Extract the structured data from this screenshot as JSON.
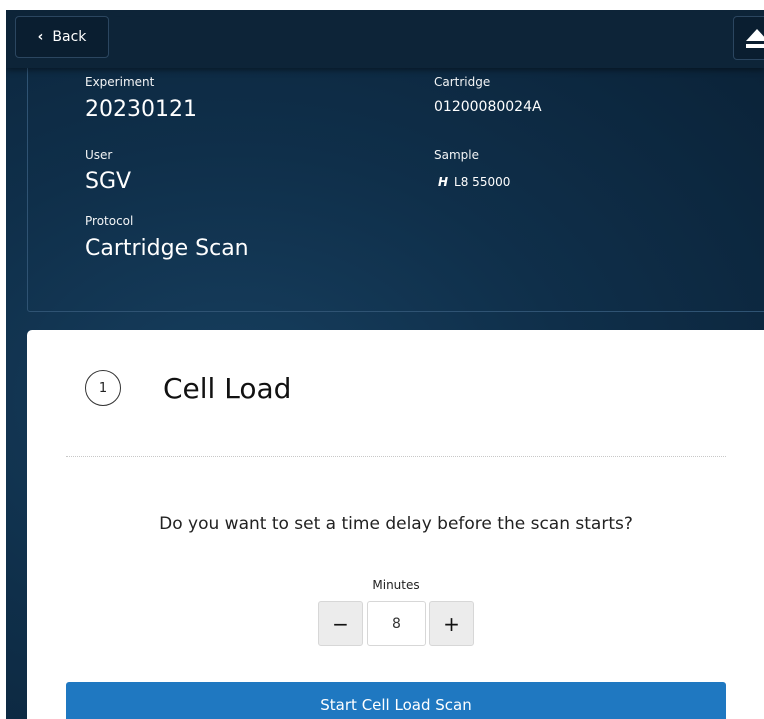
{
  "header": {
    "back_label": "Back",
    "back_icon": "chevron-left-icon",
    "eject_icon": "eject-icon"
  },
  "info": {
    "experiment_label": "Experiment",
    "experiment_value": "20230121",
    "cartridge_label": "Cartridge",
    "cartridge_value": "01200080024A",
    "user_label": "User",
    "user_value": "SGV",
    "sample_label": "Sample",
    "sample_icon_text": "H",
    "sample_value": "L8 55000",
    "protocol_label": "Protocol",
    "protocol_value": "Cartridge Scan"
  },
  "step": {
    "number": "1",
    "title": "Cell Load",
    "question": "Do you want to set a time delay before the scan starts?",
    "minutes_label": "Minutes",
    "minutes_value": "8",
    "decrement_label": "−",
    "increment_label": "+",
    "start_label": "Start Cell Load Scan"
  },
  "colors": {
    "primary_button": "#1f78c1",
    "topbar": "#0d2438",
    "panel_bg": "#0f2f4a"
  }
}
